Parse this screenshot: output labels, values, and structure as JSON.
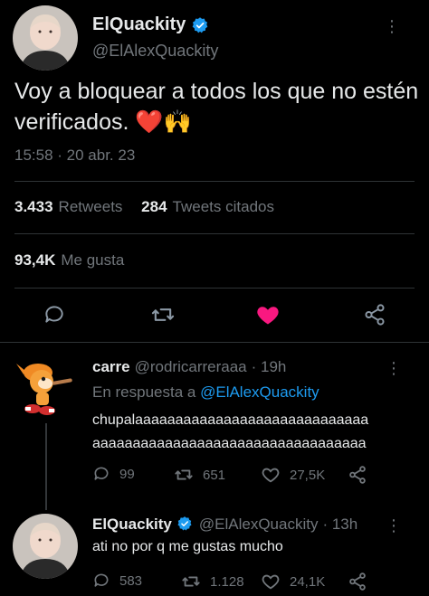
{
  "main_tweet": {
    "display_name": "ElQuackity",
    "handle": "@ElAlexQuackity",
    "text": "Voy a bloquear a todos los que no estén verificados. ❤️🙌",
    "timestamp": "15:58 · 20 abr. 23",
    "stats": {
      "retweets_count": "3.433",
      "retweets_label": "Retweets",
      "quotes_count": "284",
      "quotes_label": "Tweets citados",
      "likes_count": "93,4K",
      "likes_label": "Me gusta"
    },
    "liked": true,
    "icons": [
      "reply-icon",
      "retweet-icon",
      "heart-icon",
      "share-icon"
    ]
  },
  "replies": [
    {
      "display_name": "carre",
      "handle": "@rodricarreraaa",
      "time": "· 19h",
      "reply_to_prefix": "En respuesta a",
      "reply_to_handle": "@ElAlexQuackity",
      "text_line1": "chupalaaaaaaaaaaaaaaaaaaaaaaaaaaaaa",
      "text_line2": "aaaaaaaaaaaaaaaaaaaaaaaaaaaaaaaaaa",
      "replies": "99",
      "retweets": "651",
      "likes": "27,5K"
    },
    {
      "display_name": "ElQuackity",
      "handle": "@ElAlexQuackity",
      "time": "· 13h",
      "text": "ati no por q me gustas mucho",
      "replies": "583",
      "retweets": "1.128",
      "likes": "24,1K"
    }
  ],
  "colors": {
    "background": "#000000",
    "text": "#e7e9ea",
    "muted": "#71767b",
    "accent": "#1d9bf0",
    "like": "#f91880"
  }
}
